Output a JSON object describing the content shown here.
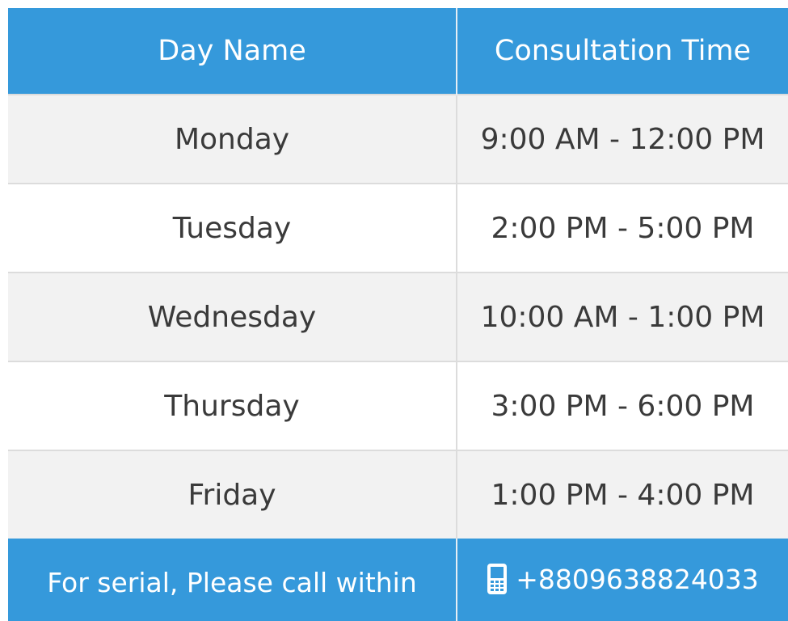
{
  "colors": {
    "header_bg": "#3599DB",
    "header_text": "#FFFFFF",
    "row_odd_bg": "#F2F2F2",
    "row_even_bg": "#FFFFFF",
    "body_text": "#3A3A3A"
  },
  "table": {
    "headers": {
      "day": "Day Name",
      "time": "Consultation Time"
    },
    "rows": [
      {
        "day": "Monday",
        "time": "9:00 AM - 12:00 PM"
      },
      {
        "day": "Tuesday",
        "time": "2:00 PM - 5:00 PM"
      },
      {
        "day": "Wednesday",
        "time": "10:00 AM - 1:00 PM"
      },
      {
        "day": "Thursday",
        "time": "3:00 PM - 6:00 PM"
      },
      {
        "day": "Friday",
        "time": "1:00 PM - 4:00 PM"
      }
    ],
    "footer": {
      "label": "For serial, Please call within",
      "phone_icon": "mobile-phone-icon",
      "phone": "+8809638824033"
    }
  }
}
